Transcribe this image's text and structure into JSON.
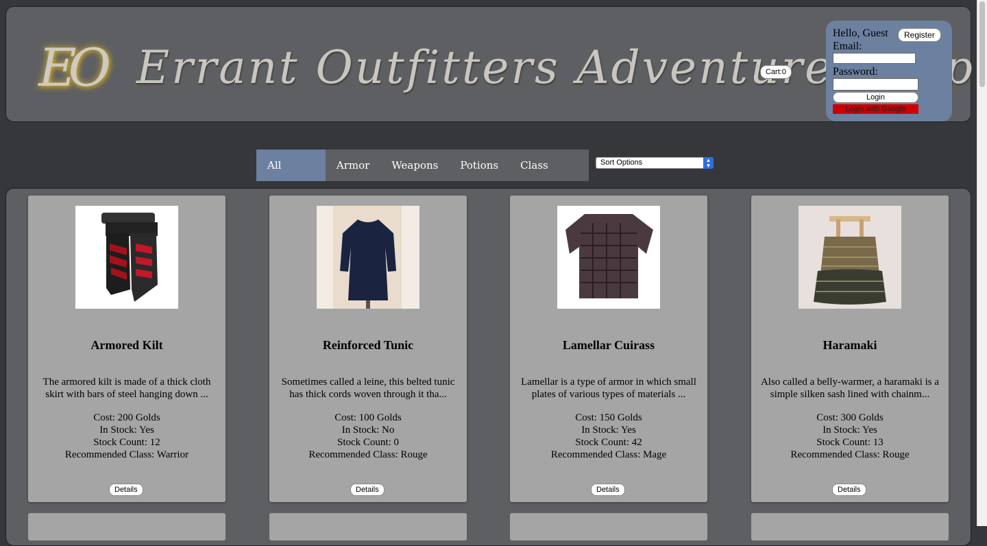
{
  "header": {
    "logo_text": "EO",
    "title": "Errant Outfitters Adventure Shop",
    "cart_label": "Cart:0"
  },
  "login": {
    "greeting": "Hello, Guest",
    "register_label": "Register",
    "email_label": "Email:",
    "password_label": "Password:",
    "login_label": "Login",
    "google_label": "Login with Google"
  },
  "nav": {
    "tabs": [
      {
        "label": "All Products",
        "active": true
      },
      {
        "label": "Armor"
      },
      {
        "label": "Weapons"
      },
      {
        "label": "Potions"
      },
      {
        "label": "Class Products"
      }
    ],
    "sort_selected": "Sort Options"
  },
  "products": [
    {
      "name": "Armored Kilt",
      "description": "The armored kilt is made of a thick cloth skirt with bars of steel hanging down ...",
      "cost": "Cost: 200 Golds",
      "in_stock": "In Stock: Yes",
      "stock_count": "Stock Count: 12",
      "recommended": "Recommended Class: Warrior",
      "details_label": "Details"
    },
    {
      "name": "Reinforced Tunic",
      "description": "Sometimes called a leine, this belted tunic has thick cords woven through it tha...",
      "cost": "Cost: 100 Golds",
      "in_stock": "In Stock: No",
      "stock_count": "Stock Count: 0",
      "recommended": "Recommended Class: Rouge",
      "details_label": "Details"
    },
    {
      "name": "Lamellar Cuirass",
      "description": "Lamellar is a type of armor in which small plates of various types of materials ...",
      "cost": "Cost: 150 Golds",
      "in_stock": "In Stock: Yes",
      "stock_count": "Stock Count: 42",
      "recommended": "Recommended Class: Mage",
      "details_label": "Details"
    },
    {
      "name": "Haramaki",
      "description": "Also called a belly-warmer, a haramaki is a simple silken sash lined with chainm...",
      "cost": "Cost: 300 Golds",
      "in_stock": "In Stock: Yes",
      "stock_count": "Stock Count: 13",
      "recommended": "Recommended Class: Rouge",
      "details_label": "Details"
    }
  ],
  "colors": {
    "page_bg": "#36373a",
    "panel_bg": "#5e5f62",
    "accent": "#6c80a0",
    "card_bg": "#a5a5a5",
    "google_red": "#cc0000"
  }
}
